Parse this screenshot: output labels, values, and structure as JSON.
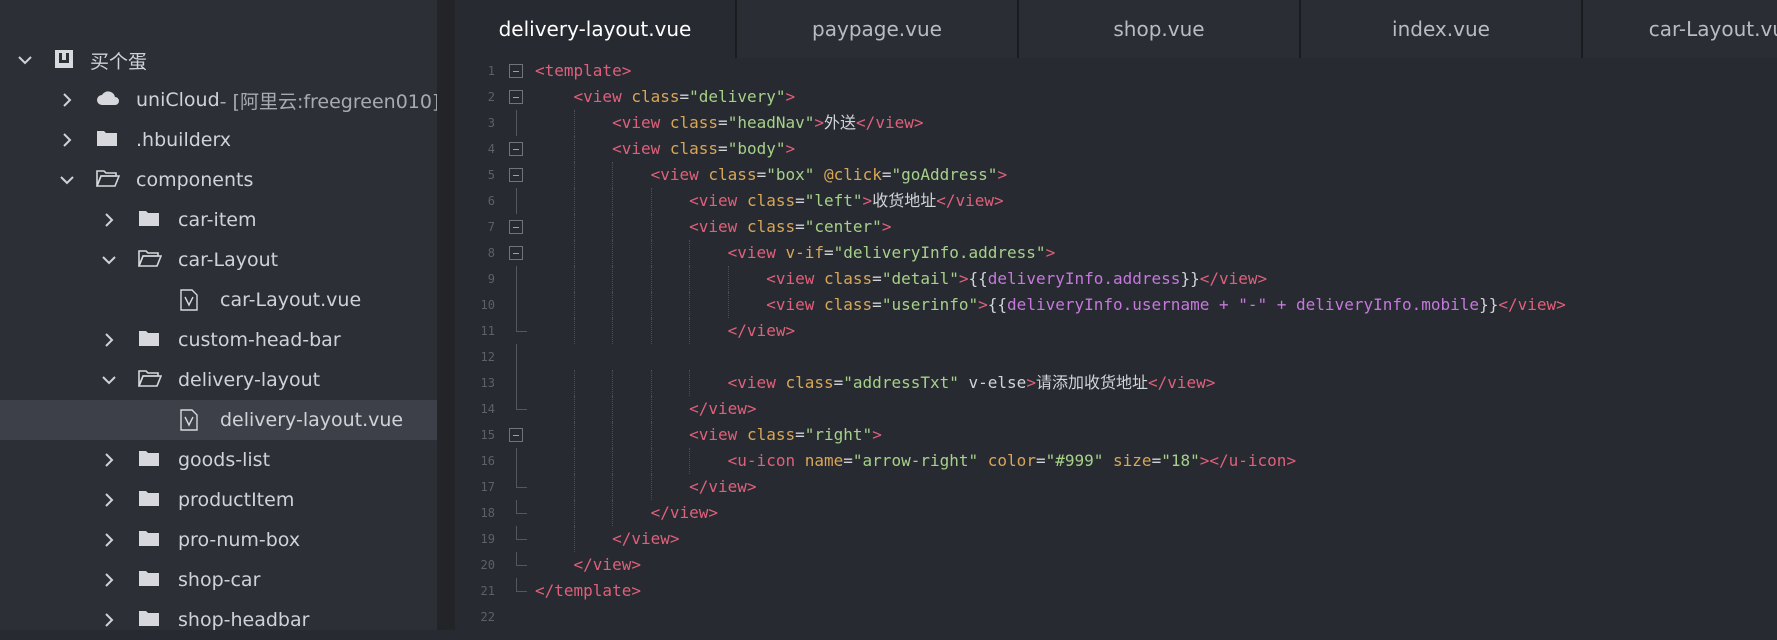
{
  "sidebar": {
    "project": "买个蛋",
    "items": [
      {
        "label": "uniCloud",
        "extra": " - [阿里云:freegreen010]",
        "icon": "cloud-folder-icon",
        "chevron": "right"
      },
      {
        "label": ".hbuilderx",
        "icon": "folder-icon",
        "chevron": "right"
      },
      {
        "label": "components",
        "icon": "folder-open-icon",
        "chevron": "down"
      },
      {
        "label": "car-item",
        "icon": "folder-icon",
        "chevron": "right"
      },
      {
        "label": "car-Layout",
        "icon": "folder-open-icon",
        "chevron": "down"
      },
      {
        "label": "car-Layout.vue",
        "icon": "vue-file-icon",
        "chevron": "none"
      },
      {
        "label": "custom-head-bar",
        "icon": "folder-icon",
        "chevron": "right"
      },
      {
        "label": "delivery-layout",
        "icon": "folder-open-icon",
        "chevron": "down"
      },
      {
        "label": "delivery-layout.vue",
        "icon": "vue-file-icon",
        "chevron": "none",
        "selected": true
      },
      {
        "label": "goods-list",
        "icon": "folder-icon",
        "chevron": "right"
      },
      {
        "label": "productItem",
        "icon": "folder-icon",
        "chevron": "right"
      },
      {
        "label": "pro-num-box",
        "icon": "folder-icon",
        "chevron": "right"
      },
      {
        "label": "shop-car",
        "icon": "folder-icon",
        "chevron": "right"
      },
      {
        "label": "shop-headbar",
        "icon": "folder-icon",
        "chevron": "right"
      }
    ]
  },
  "tabs": [
    "delivery-layout.vue",
    "paypage.vue",
    "shop.vue",
    "index.vue",
    "car-Layout.vue"
  ],
  "active_tab": 0,
  "code": [
    {
      "n": "1",
      "fold": "box",
      "text": "<template>"
    },
    {
      "n": "2",
      "fold": "box",
      "text": "    <view class=\"delivery\">"
    },
    {
      "n": "3",
      "fold": "bar",
      "text": "        <view class=\"headNav\">外送</view>"
    },
    {
      "n": "4",
      "fold": "box",
      "text": "        <view class=\"body\">"
    },
    {
      "n": "5",
      "fold": "box",
      "text": "            <view class=\"box\" @click=\"goAddress\">"
    },
    {
      "n": "6",
      "fold": "bar",
      "text": "                <view class=\"left\">收货地址</view>"
    },
    {
      "n": "7",
      "fold": "box",
      "text": "                <view class=\"center\">"
    },
    {
      "n": "8",
      "fold": "box",
      "text": "                    <view v-if=\"deliveryInfo.address\">"
    },
    {
      "n": "9",
      "fold": "bar",
      "text": "                        <view class=\"detail\">{{deliveryInfo.address}}</view>"
    },
    {
      "n": "10",
      "fold": "bar",
      "text": "                        <view class=\"userinfo\">{{deliveryInfo.username + \"-\" + deliveryInfo.mobile}}</view>"
    },
    {
      "n": "11",
      "fold": "end",
      "text": "                    </view>"
    },
    {
      "n": "12",
      "fold": "bar",
      "text": ""
    },
    {
      "n": "13",
      "fold": "bar",
      "text": "                    <view class=\"addressTxt\" v-else>请添加收货地址</view>"
    },
    {
      "n": "14",
      "fold": "end",
      "text": "                </view>"
    },
    {
      "n": "15",
      "fold": "box",
      "text": "                <view class=\"right\">"
    },
    {
      "n": "16",
      "fold": "bar",
      "text": "                    <u-icon name=\"arrow-right\" color=\"#999\" size=\"18\"></u-icon>"
    },
    {
      "n": "17",
      "fold": "end",
      "text": "                </view>"
    },
    {
      "n": "18",
      "fold": "end",
      "text": "            </view>"
    },
    {
      "n": "19",
      "fold": "end",
      "text": "        </view>"
    },
    {
      "n": "20",
      "fold": "end",
      "text": "    </view>"
    },
    {
      "n": "21",
      "fold": "end",
      "text": "</template>"
    },
    {
      "n": "22",
      "fold": "none",
      "text": ""
    }
  ]
}
